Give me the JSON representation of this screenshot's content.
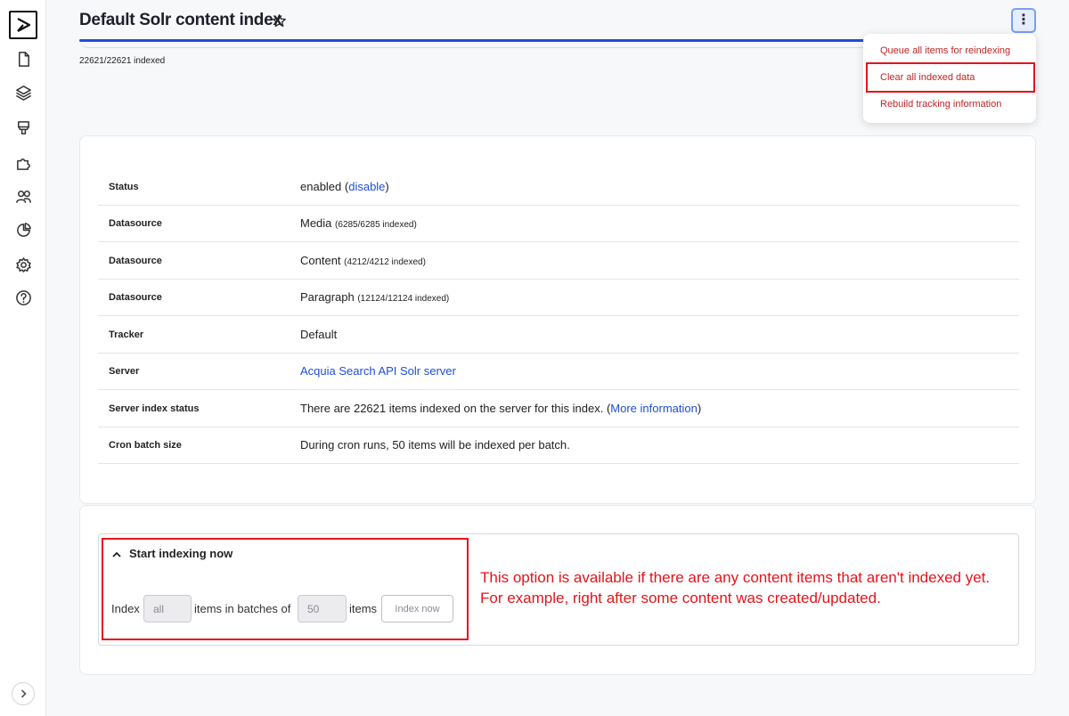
{
  "header": {
    "title": "Default Solr content index",
    "indexed_count": "22621/22621 indexed",
    "progress_fraction": 1.0
  },
  "dropdown": {
    "items": [
      "Queue all items for reindexing",
      "Clear all indexed data",
      "Rebuild tracking information"
    ]
  },
  "info_rows": [
    {
      "label": "Status",
      "value_pre": "enabled (",
      "value_link": "disable",
      "value_post": ")"
    },
    {
      "label": "Datasource",
      "value": "Media",
      "value_small": "(6285/6285 indexed)"
    },
    {
      "label": "Datasource",
      "value": "Content",
      "value_small": "(4212/4212 indexed)"
    },
    {
      "label": "Datasource",
      "value": "Paragraph",
      "value_small": "(12124/12124 indexed)"
    },
    {
      "label": "Tracker",
      "value": "Default"
    },
    {
      "label": "Server",
      "value_link": "Acquia Search API Solr server"
    },
    {
      "label": "Server index status",
      "value_pre": "There are 22621 items indexed on the server for this index. (",
      "value_link": "More information",
      "value_post": ")"
    },
    {
      "label": "Cron batch size",
      "value": "During cron runs, 50 items will be indexed per batch."
    }
  ],
  "indexing": {
    "summary": "Start indexing now",
    "index_label": "Index",
    "index_value": "all",
    "batches_label": "items in batches of",
    "batch_value": "50",
    "items_label": "items",
    "button": "Index now"
  },
  "annotation": {
    "line1": "This option is available if there are any content items that aren't indexed yet.",
    "line2": "For example, right after some content was created/updated."
  },
  "colors": {
    "accent": "#1d4fd8",
    "danger": "#c22424",
    "highlight": "#e4141a"
  }
}
